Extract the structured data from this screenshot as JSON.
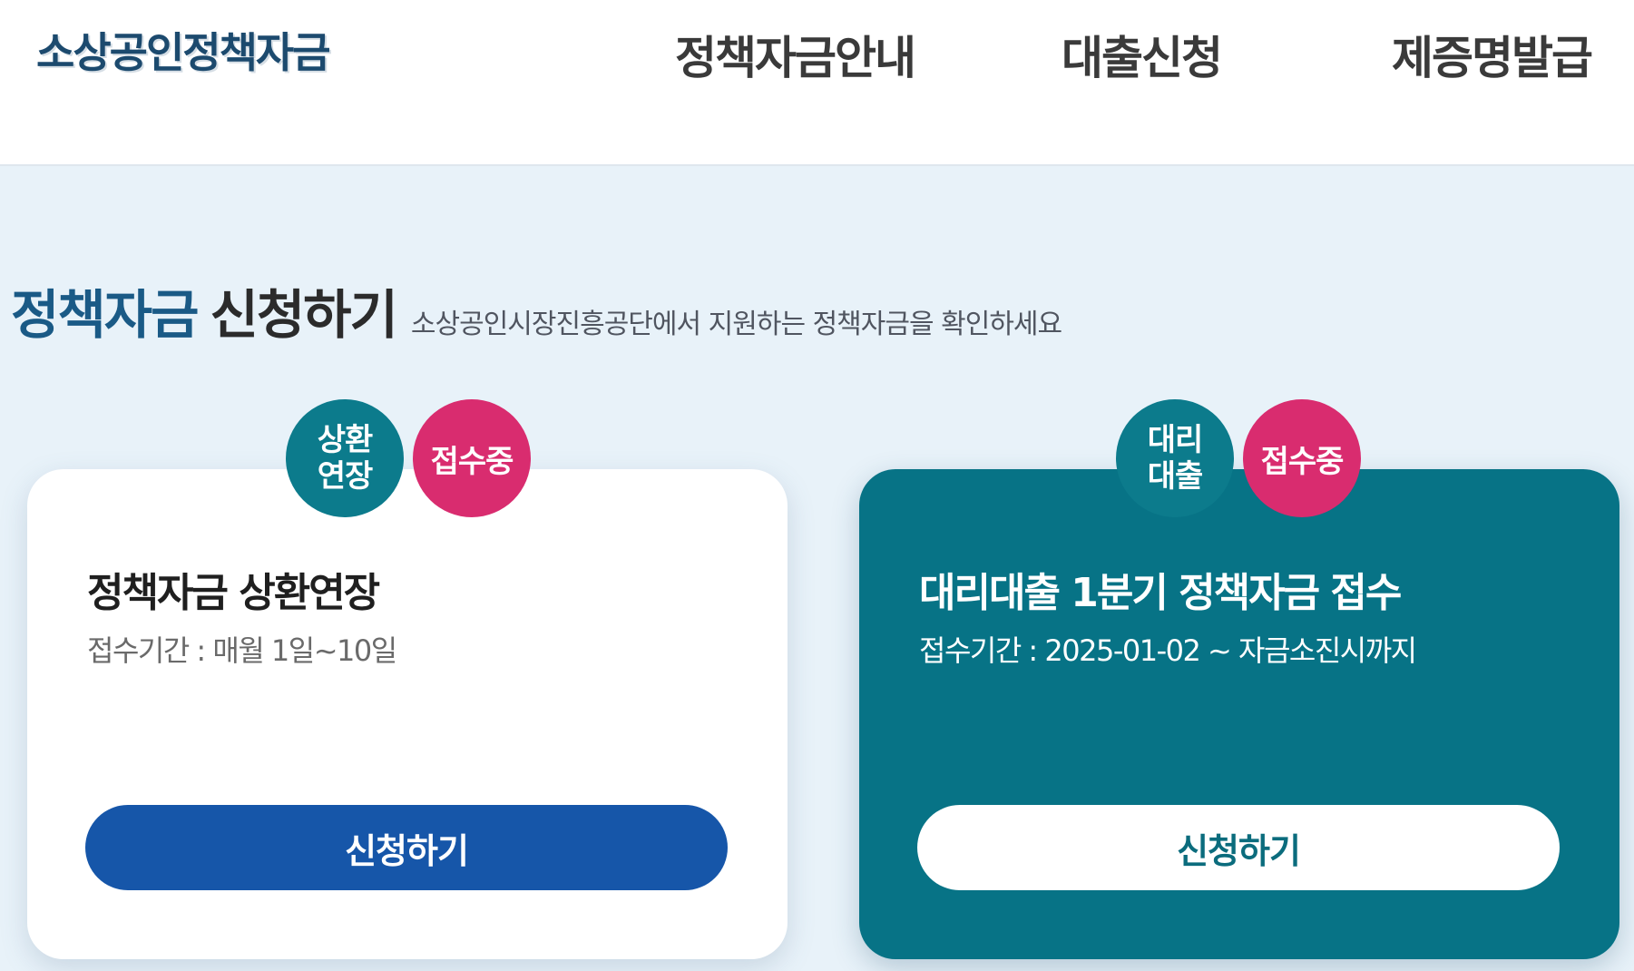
{
  "header": {
    "logo": "소상공인정책자금",
    "nav": [
      "정책자금안내",
      "대출신청",
      "제증명발급"
    ]
  },
  "section": {
    "title_highlight": "정책자금",
    "title_rest": "신청하기",
    "subtitle": "소상공인시장진흥공단에서 지원하는 정책자금을 확인하세요"
  },
  "cards": [
    {
      "badges": [
        "상환\n연장",
        "접수중"
      ],
      "title": "정책자금 상환연장",
      "period": "접수기간 : 매월 1일~10일",
      "button": "신청하기"
    },
    {
      "badges": [
        "대리\n대출",
        "접수중"
      ],
      "title": "대리대출 1분기 정책자금 접수",
      "period": "접수기간 : 2025-01-02 ~ 자금소진시까지",
      "button": "신청하기"
    }
  ],
  "colors": {
    "brand_navy": "#1c4a6e",
    "page_bg": "#e8f2f9",
    "teal_card": "#077386",
    "badge_teal": "#0c7b8c",
    "badge_pink": "#d92c6f",
    "button_blue": "#1656a9"
  }
}
